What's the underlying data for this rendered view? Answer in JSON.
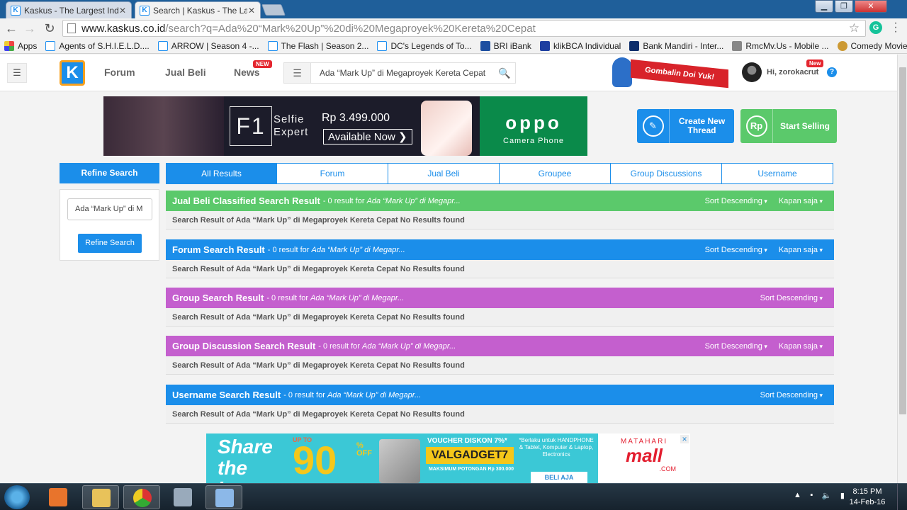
{
  "browser": {
    "tabs": [
      {
        "label": "Kaskus - The Largest Indo",
        "active": false
      },
      {
        "label": "Search | Kaskus - The Larg",
        "active": true
      }
    ],
    "url_host": "www.kaskus.co.id",
    "url_path": "/search?q=Ada%20“Mark%20Up”%20di%20Megaproyek%20Kereta%20Cepat",
    "bookmarks": [
      {
        "label": "Apps",
        "icon": "apps-grid-icon"
      },
      {
        "label": "Agents of S.H.I.E.L.D....",
        "icon": "kaskus-icon"
      },
      {
        "label": "ARROW | Season 4 -...",
        "icon": "kaskus-icon"
      },
      {
        "label": "The Flash | Season 2...",
        "icon": "kaskus-icon"
      },
      {
        "label": "DC's Legends of To...",
        "icon": "kaskus-icon"
      },
      {
        "label": "BRI iBank",
        "icon": "bri-icon"
      },
      {
        "label": "klikBCA Individual",
        "icon": "bca-icon"
      },
      {
        "label": "Bank Mandiri - Inter...",
        "icon": "mandiri-icon"
      },
      {
        "label": "RmcMv.Us - Mobile ...",
        "icon": "rmc-icon"
      },
      {
        "label": "Comedy Movies | Tri...",
        "icon": "comedy-icon"
      }
    ]
  },
  "header": {
    "logo": "K",
    "nav": {
      "forum": "Forum",
      "jual_beli": "Jual Beli",
      "news": "News",
      "new_badge": "NEW"
    },
    "search_value": "Ada “Mark Up” di Megaproyek Kereta Cepat",
    "promo": "Gombalin Doi Yuk!",
    "greeting": "Hi, zorokacrut",
    "user_new_badge": "New",
    "help": "?"
  },
  "ad_top": {
    "f1": "F1",
    "selfie": "Selfie",
    "expert": "Expert",
    "price": "Rp 3.499.000",
    "available": "Available Now ❯",
    "brand": "oppo",
    "brand_sub": "Camera Phone"
  },
  "cta": {
    "create_line1": "Create New",
    "create_line2": "Thread",
    "sell": "Start Selling",
    "rp": "Rp"
  },
  "sidebar": {
    "title": "Refine Search",
    "input_value": "Ada “Mark Up” di M",
    "button": "Refine Search"
  },
  "search_tabs": [
    {
      "label": "All Results",
      "active": true
    },
    {
      "label": "Forum",
      "active": false
    },
    {
      "label": "Jual Beli",
      "active": false
    },
    {
      "label": "Groupee",
      "active": false
    },
    {
      "label": "Group Discussions",
      "active": false
    },
    {
      "label": "Username",
      "active": false
    }
  ],
  "sections": [
    {
      "title": "Jual Beli Classified Search Result",
      "meta": "- 0 result for",
      "query": "Ada “Mark Up” di Megapr...",
      "sort": "Sort Descending",
      "time": "Kapan saja",
      "body": "Search Result of Ada “Mark Up” di Megaproyek Kereta Cepat No Results found",
      "color": "#5bc96b"
    },
    {
      "title": "Forum Search Result",
      "meta": "- 0 result for",
      "query": "Ada “Mark Up” di Megapr...",
      "sort": "Sort Descending",
      "time": "Kapan saja",
      "body": "Search Result of Ada “Mark Up” di Megaproyek Kereta Cepat No Results found",
      "color": "#1b8eea"
    },
    {
      "title": "Group Search Result",
      "meta": "- 0 result for",
      "query": "Ada “Mark Up” di Megapr...",
      "sort": "Sort Descending",
      "time": "",
      "body": "Search Result of Ada “Mark Up” di Megaproyek Kereta Cepat No Results found",
      "color": "#c45fce"
    },
    {
      "title": "Group Discussion Search Result",
      "meta": "- 0 result for",
      "query": "Ada “Mark Up” di Megapr...",
      "sort": "Sort Descending",
      "time": "Kapan saja",
      "body": "Search Result of Ada “Mark Up” di Megaproyek Kereta Cepat No Results found",
      "color": "#c45fce"
    },
    {
      "title": "Username Search Result",
      "meta": "- 0 result for",
      "query": "Ada “Mark Up” di Megapr...",
      "sort": "Sort Descending",
      "time": "",
      "body": "Search Result of Ada “Mark Up” di Megaproyek Kereta Cepat No Results found",
      "color": "#1b8eea"
    }
  ],
  "ad_bottom": {
    "share": "Share the love",
    "up_to": "UP TO",
    "ninety": "90",
    "pct_off": "% OFF",
    "voucher_head": "VOUCHER DISKON 7%*",
    "voucher_code": "VALGADGET7",
    "max_potongan": "MAKSIMUM POTONGAN Rp 300.000",
    "berlaku": "*Berlaku untuk HANDPHONE & Tablet, Komputer & Laptop, Electronics",
    "beli": "BELI AJA",
    "matahari": "MATAHARI",
    "mall": "mall",
    "dotcom": ".COM"
  },
  "taskbar": {
    "time": "8:15 PM",
    "date": "14-Feb-16"
  }
}
